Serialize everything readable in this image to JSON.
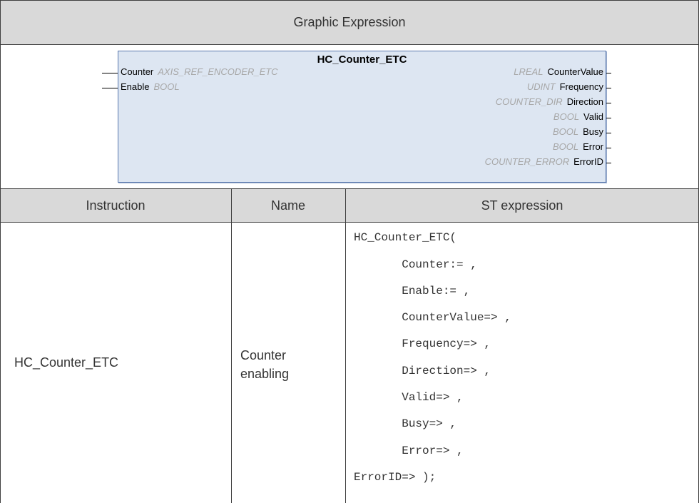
{
  "graphic_header": "Graphic Expression",
  "fb": {
    "name": "HC_Counter_ETC",
    "inputs": [
      {
        "name": "Counter",
        "type": "AXIS_REF_ENCODER_ETC"
      },
      {
        "name": "Enable",
        "type": "BOOL"
      }
    ],
    "outputs": [
      {
        "name": "CounterValue",
        "type": "LREAL"
      },
      {
        "name": "Frequency",
        "type": "UDINT"
      },
      {
        "name": "Direction",
        "type": "COUNTER_DIR"
      },
      {
        "name": "Valid",
        "type": "BOOL"
      },
      {
        "name": "Busy",
        "type": "BOOL"
      },
      {
        "name": "Error",
        "type": "BOOL"
      },
      {
        "name": "ErrorID",
        "type": "COUNTER_ERROR"
      }
    ]
  },
  "table": {
    "headers": {
      "instruction": "Instruction",
      "name": "Name",
      "st": "ST expression"
    },
    "row": {
      "instruction": "HC_Counter_ETC",
      "name_line1": "Counter",
      "name_line2": "enabling",
      "st_lines": [
        "HC_Counter_ETC(",
        "       Counter:= ,",
        "       Enable:= ,",
        "       CounterValue=> ,",
        "       Frequency=> ,",
        "       Direction=> ,",
        "       Valid=> ,",
        "       Busy=> ,",
        "       Error=> ,",
        "ErrorID=> );"
      ]
    }
  }
}
